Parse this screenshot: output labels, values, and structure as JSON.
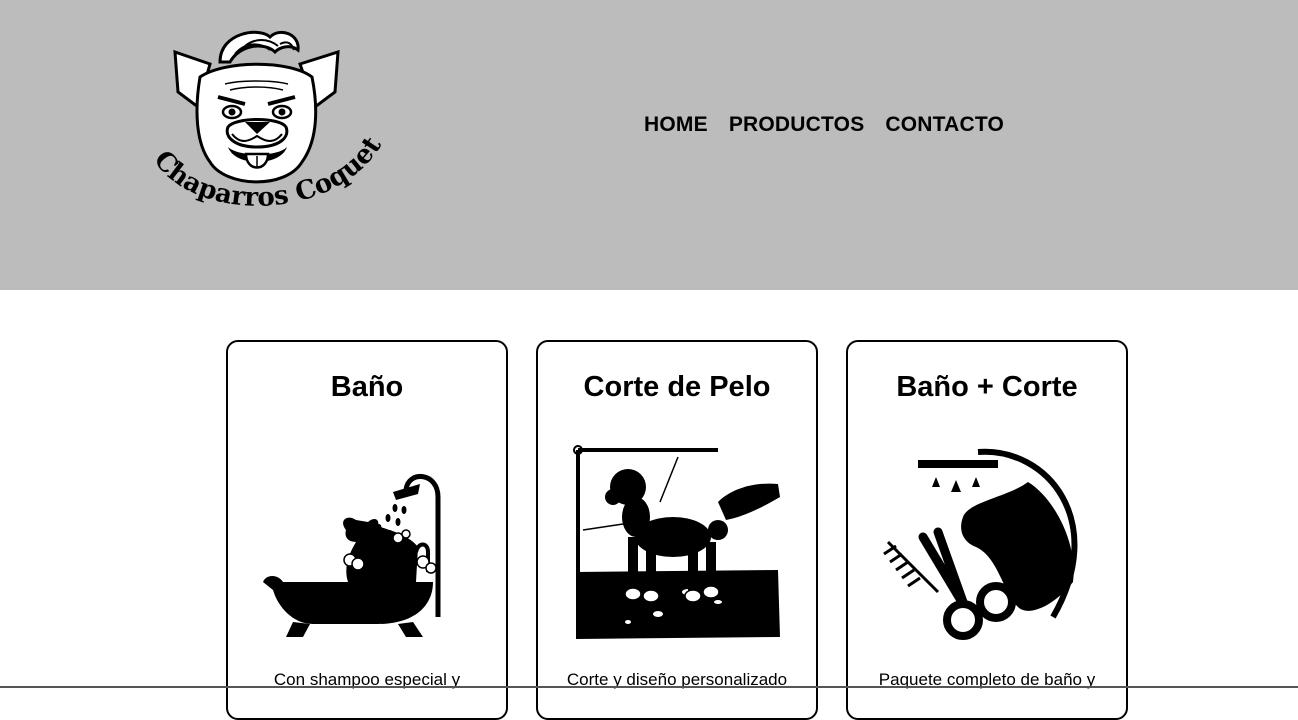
{
  "header": {
    "logo_text": "Chaparros Coquetos",
    "background": "#bcbcbc"
  },
  "nav": {
    "items": [
      {
        "label": "HOME"
      },
      {
        "label": "PRODUCTOS"
      },
      {
        "label": "CONTACTO"
      }
    ]
  },
  "cards": [
    {
      "title": "Baño",
      "description": "Con shampoo especial y",
      "icon": "dog-bathtub-icon"
    },
    {
      "title": "Corte de Pelo",
      "description": "Corte y diseño personalizado",
      "icon": "poodle-grooming-icon"
    },
    {
      "title": "Baño + Corte",
      "description": "Paquete completo de baño y",
      "icon": "shower-scissors-dog-icon"
    }
  ]
}
